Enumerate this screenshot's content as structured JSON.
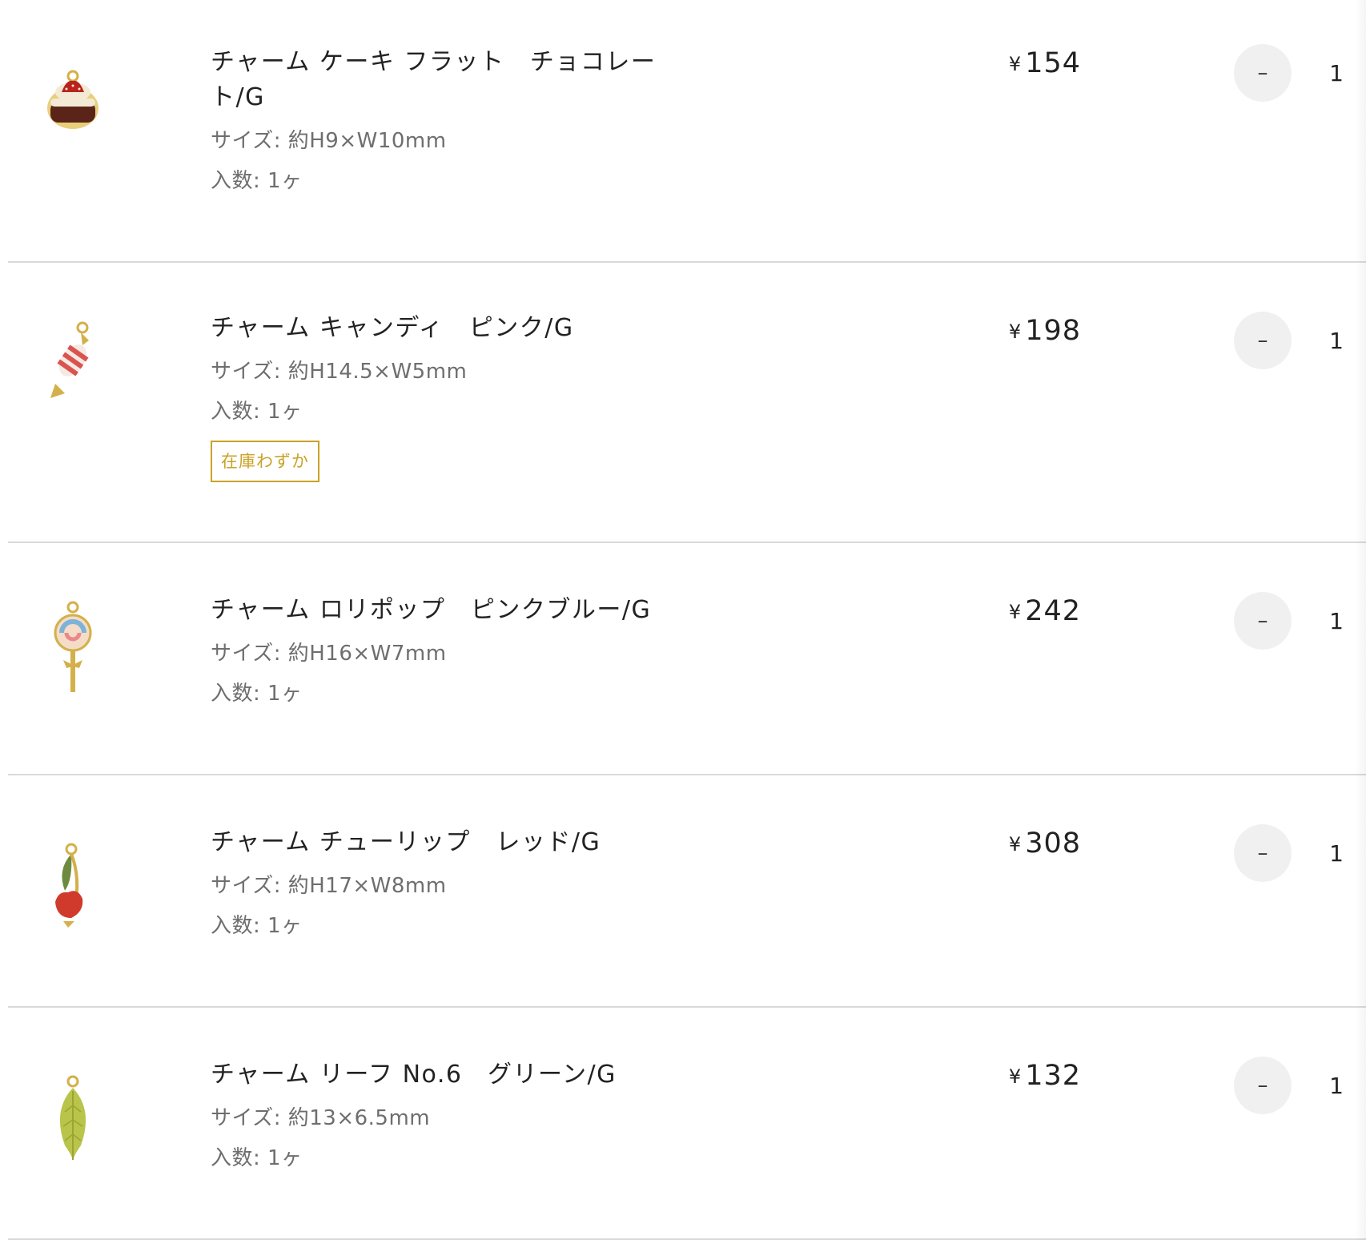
{
  "cart": {
    "currency_symbol": "¥",
    "items": [
      {
        "name": "チャーム ケーキ フラット　チョコレート/G",
        "size": "サイズ: 約H9×W10mm",
        "count": "入数: 1ヶ",
        "badge": "",
        "price": "154",
        "minus_label": "–",
        "quantity": "1",
        "icon": "cake-charm-icon"
      },
      {
        "name": "チャーム キャンディ　ピンク/G",
        "size": "サイズ: 約H14.5×W5mm",
        "count": "入数: 1ヶ",
        "badge": "在庫わずか",
        "price": "198",
        "minus_label": "–",
        "quantity": "1",
        "icon": "candy-charm-icon"
      },
      {
        "name": "チャーム ロリポップ　ピンクブルー/G",
        "size": "サイズ: 約H16×W7mm",
        "count": "入数: 1ヶ",
        "badge": "",
        "price": "242",
        "minus_label": "–",
        "quantity": "1",
        "icon": "lollipop-charm-icon"
      },
      {
        "name": "チャーム チューリップ　レッド/G",
        "size": "サイズ: 約H17×W8mm",
        "count": "入数: 1ヶ",
        "badge": "",
        "price": "308",
        "minus_label": "–",
        "quantity": "1",
        "icon": "tulip-charm-icon"
      },
      {
        "name": "チャーム リーフ No.6　グリーン/G",
        "size": "サイズ: 約13×6.5mm",
        "count": "入数: 1ヶ",
        "badge": "",
        "price": "132",
        "minus_label": "–",
        "quantity": "1",
        "icon": "leaf-charm-icon"
      }
    ],
    "colors": {
      "badge": "#c9a227",
      "divider": "#d9d9d9",
      "stepper_bg": "#f0f0f0",
      "meta_text": "#6e6e6e"
    }
  }
}
